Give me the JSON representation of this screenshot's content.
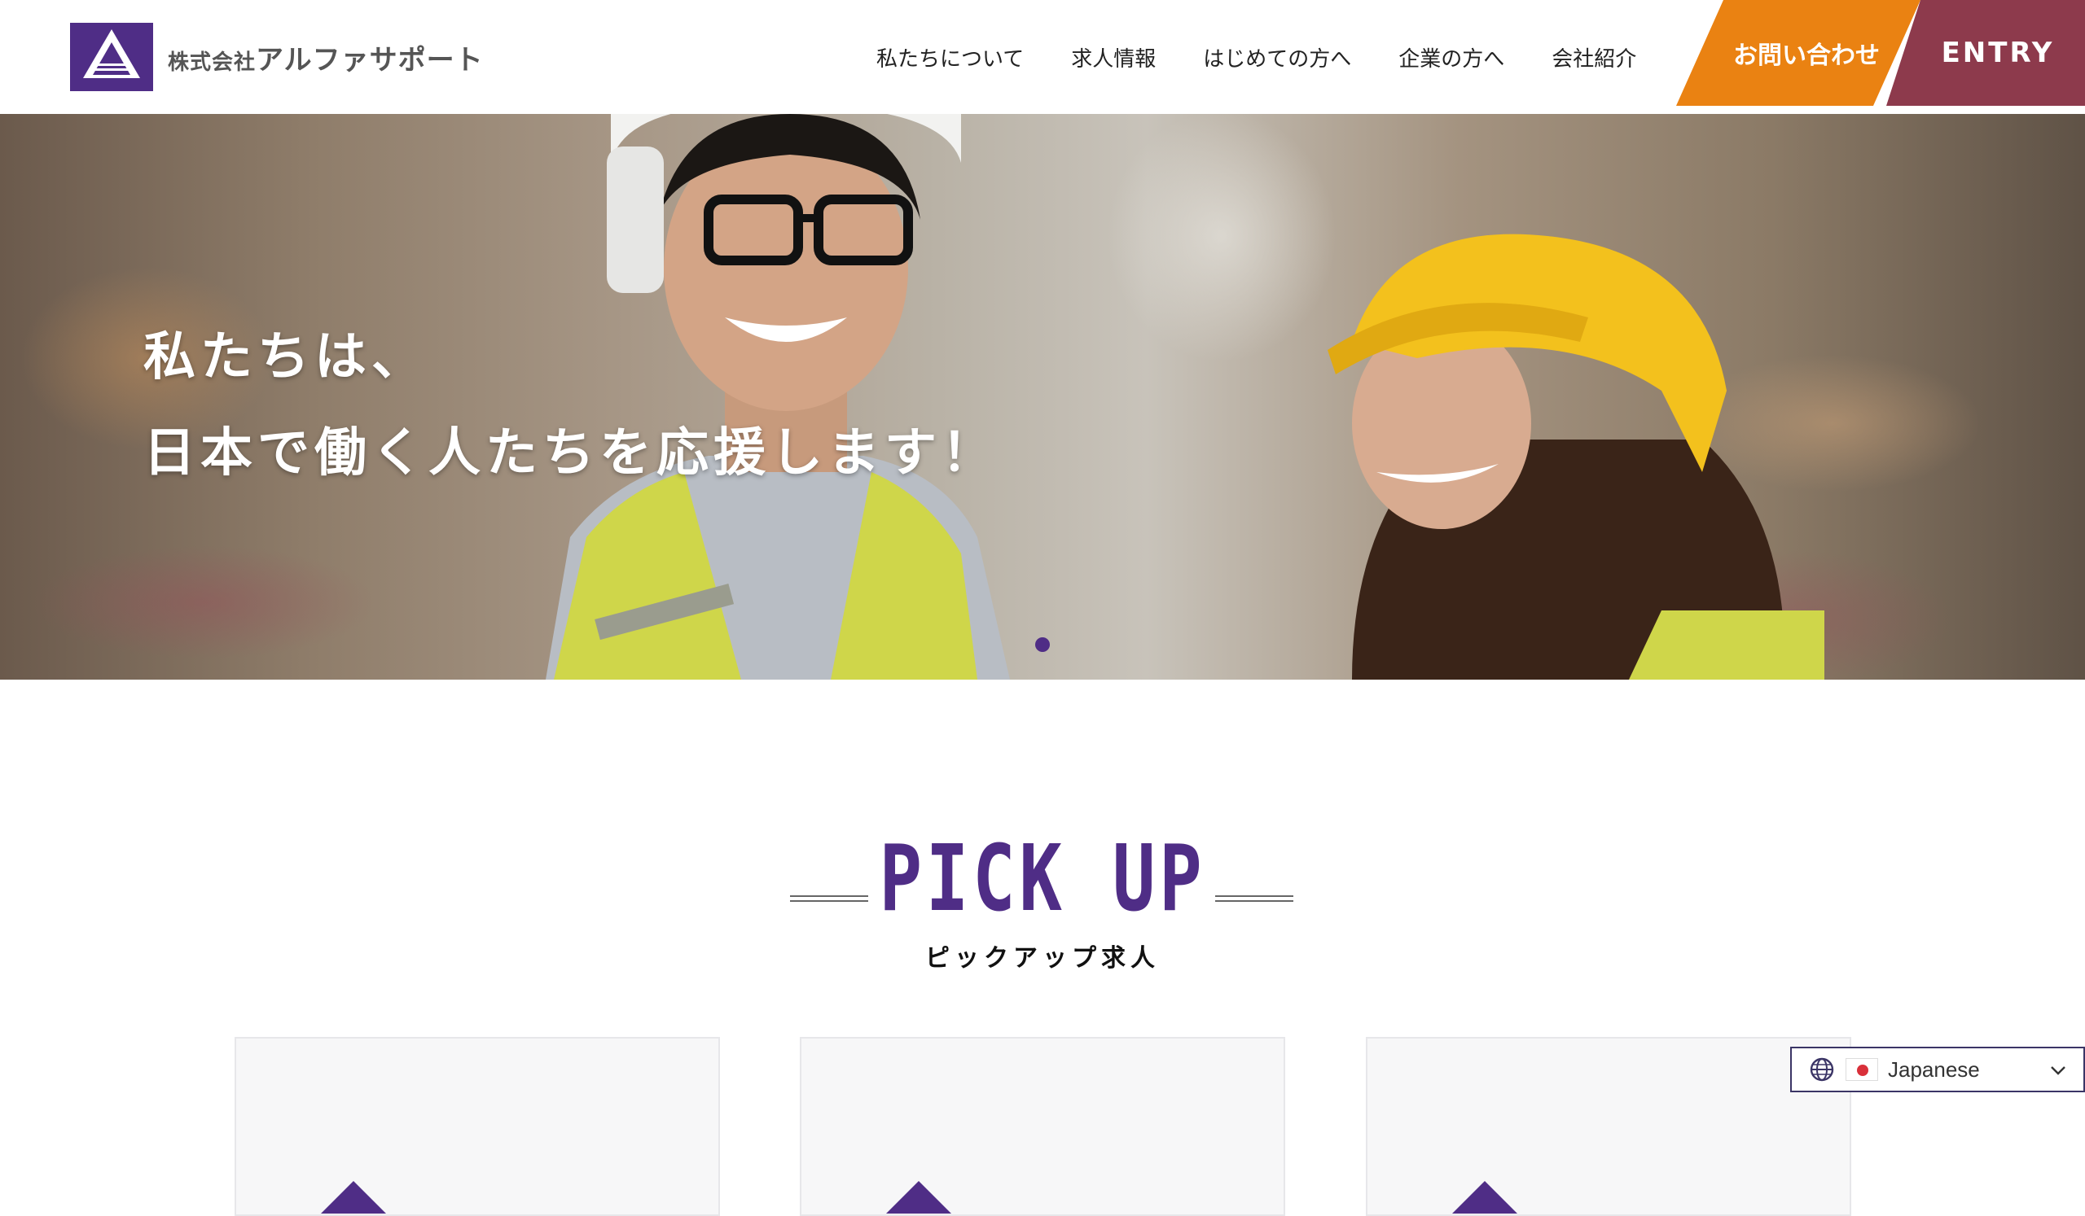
{
  "header": {
    "company_prefix": "株式会社",
    "company_name": "アルファサポート",
    "nav": [
      {
        "label": "私たちについて"
      },
      {
        "label": "求人情報"
      },
      {
        "label": "はじめての方へ"
      },
      {
        "label": "企業の方へ"
      },
      {
        "label": "会社紹介"
      }
    ],
    "contact_label": "お問い合わせ",
    "entry_label": "ENTRY",
    "logo_icon": "alpha-a-logo-icon"
  },
  "hero": {
    "line1": "私たちは、",
    "line2": "日本で働く人たちを応援します！",
    "slide_count": 1,
    "active_slide": 1
  },
  "pickup": {
    "title": "PICK UP",
    "subtitle": "ピックアップ求人",
    "cards": [
      {
        "id": 1
      },
      {
        "id": 2
      },
      {
        "id": 3
      }
    ]
  },
  "language": {
    "label": "Japanese",
    "icon": "globe-icon"
  },
  "colors": {
    "brand_purple": "#4f2d86",
    "contact_orange": "#ea8212",
    "entry_maroon": "#8d3a4c"
  }
}
